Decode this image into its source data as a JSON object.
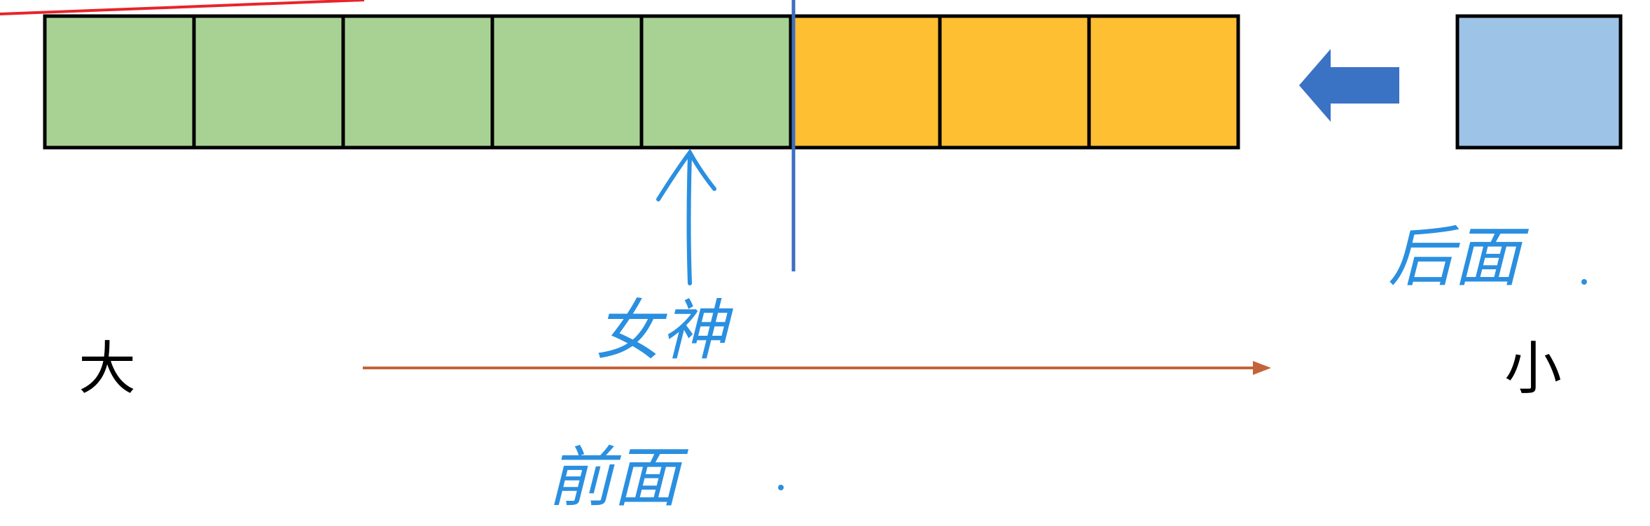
{
  "colors": {
    "green_cell": "#a8d294",
    "orange_cell": "#ffbf33",
    "incoming_cell": "#9dc3e6",
    "cell_border": "#000000",
    "divider": "#3e6ebf",
    "push_arrow": "#3a72c4",
    "order_arrow": "#c4633a",
    "handwriting": "#2a8fe0",
    "red_stroke": "#e8242a"
  },
  "cells": {
    "green_count": 5,
    "orange_count": 3
  },
  "labels": {
    "big": "大",
    "small": "小",
    "hand_boundary": "女神",
    "hand_front": "前面",
    "hand_back": "后面"
  },
  "icons": {
    "push_arrow": "left-arrow-icon",
    "pointer_arrow": "up-arrow-icon"
  }
}
